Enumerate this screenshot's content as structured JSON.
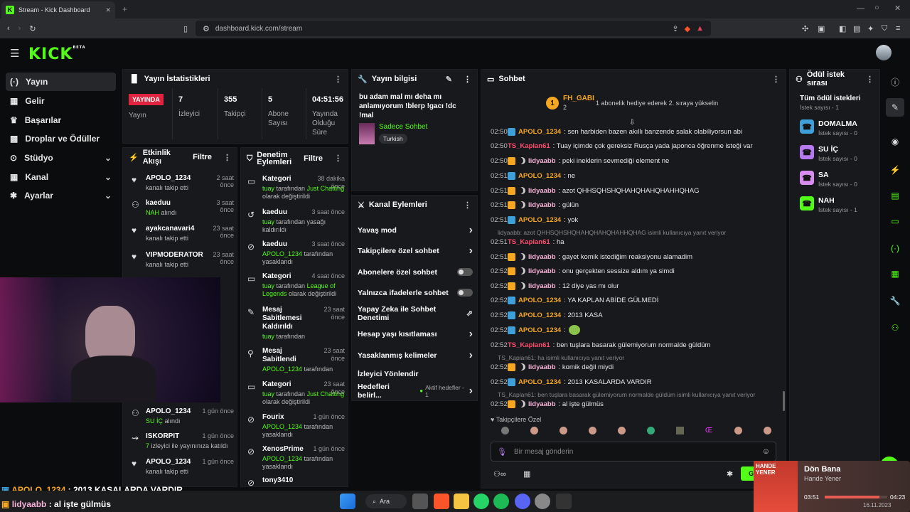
{
  "browser": {
    "tab_title": "Stream - Kick Dashboard",
    "url": "dashboard.kick.com/stream"
  },
  "brand": {
    "logo": "KICK",
    "beta": "BETA",
    "accent": "#53fc18"
  },
  "sidebar": {
    "items": [
      {
        "label": "Yayın",
        "icon": "broadcast-icon"
      },
      {
        "label": "Gelir",
        "icon": "revenue-icon"
      },
      {
        "label": "Başarılar",
        "icon": "trophy-icon"
      },
      {
        "label": "Droplar ve Ödüller",
        "icon": "gift-icon"
      },
      {
        "label": "Stüdyo",
        "icon": "studio-icon"
      },
      {
        "label": "Kanal",
        "icon": "channel-icon"
      },
      {
        "label": "Ayarlar",
        "icon": "gear-icon"
      }
    ]
  },
  "stats": {
    "title": "Yayın İstatistikleri",
    "live_badge": "YAYINDA",
    "live_label": "Yayın",
    "items": [
      {
        "value": "7",
        "label": "İzleyici"
      },
      {
        "value": "355",
        "label": "Takipçi"
      },
      {
        "value": "5",
        "label": "Abone Sayısı"
      },
      {
        "value": "04:51:56",
        "label": "Yayında Olduğu Süre"
      }
    ]
  },
  "stream_info": {
    "title": "Yayın bilgisi",
    "text": "bu adam mal mı deha mı anlamıyorum !blerp !gacı !dc !mal",
    "chat_mode": "Sadece Sohbet",
    "tag": "Turkish"
  },
  "activity": {
    "title": "Etkinlik Akışı",
    "filter": "Filtre",
    "items": [
      {
        "name": "APOLO_1234",
        "time": "2 saat önce",
        "desc": "kanalı takip etti"
      },
      {
        "name": "kaeduu",
        "time": "3 saat önce",
        "hl": "NAH",
        "desc": " alındı"
      },
      {
        "name": "ayakcanavari4",
        "time": "23 saat önce",
        "desc": "kanalı takip etti"
      },
      {
        "name": "VIPMODERATOR",
        "time": "23 saat önce",
        "desc": "kanalı takip etti"
      },
      {
        "name": "APOLO_1234",
        "time": "1 gün önce",
        "hl": "SU İÇ",
        "desc": " alındı"
      },
      {
        "name": "ISKORPIT",
        "time": "1 gün önce",
        "hl": "7",
        "desc": " izleyici ile yayınınıza katıldı"
      },
      {
        "name": "APOLO_1234",
        "time": "1 gün önce",
        "desc": "kanalı takip etti"
      }
    ]
  },
  "modlog": {
    "title": "Denetim Eylemleri",
    "filter": "Filtre",
    "items": [
      {
        "name": "Kategori",
        "time": "38 dakika önce",
        "actor": "tuay",
        "desc": " tarafından ",
        "hl2": "Just Chatting",
        "desc2": " olarak değiştirildi"
      },
      {
        "name": "kaeduu",
        "time": "3 saat önce",
        "actor": "tuay",
        "desc": " tarafından yasağı kaldırıldı"
      },
      {
        "name": "kaeduu",
        "time": "3 saat önce",
        "actor": "APOLO_1234",
        "desc": " tarafından yasaklandı"
      },
      {
        "name": "Kategori",
        "time": "4 saat önce",
        "actor": "tuay",
        "desc": " tarafından ",
        "hl2": "League of Legends",
        "desc2": " olarak değiştirildi"
      },
      {
        "name": "Mesaj Sabitlemesi Kaldırıldı",
        "time": "23 saat önce",
        "actor": "tuay",
        "desc": " tarafından"
      },
      {
        "name": "Mesaj Sabitlendi",
        "time": "23 saat önce",
        "actor": "APOLO_1234",
        "desc": " tarafından"
      },
      {
        "name": "Kategori",
        "time": "23 saat önce",
        "actor": "tuay",
        "desc": " tarafından ",
        "hl2": "Just Chatting",
        "desc2": " olarak değiştirildi"
      },
      {
        "name": "Fourix",
        "time": "1 gün önce",
        "actor": "APOLO_1234",
        "desc": " tarafından yasaklandı"
      },
      {
        "name": "XenosPrime",
        "time": "1 gün önce",
        "actor": "APOLO_1234",
        "desc": " tarafından yasaklandı"
      },
      {
        "name": "tony3410",
        "time": "",
        "actor": "",
        "desc": ""
      }
    ]
  },
  "channel_actions": {
    "title": "Kanal Eylemleri",
    "rows": [
      {
        "label": "Yavaş mod",
        "kind": "chevron"
      },
      {
        "label": "Takipçilere özel sohbet",
        "kind": "chevron"
      },
      {
        "label": "Abonelere özel sohbet",
        "kind": "toggle"
      },
      {
        "label": "Yalnızca ifadelerle sohbet",
        "kind": "toggle"
      },
      {
        "label": "Yapay Zeka ile Sohbet Denetimi",
        "kind": "external"
      },
      {
        "label": "Hesap yaşı kısıtlaması",
        "kind": "chevron"
      },
      {
        "label": "Yasaklanmış kelimeler",
        "kind": "chevron"
      },
      {
        "label": "İzleyici Yönlendir",
        "kind": "none"
      },
      {
        "label": "Hedefleri belirl...",
        "kind": "chevron",
        "extra": "Aktif hedefler - 1"
      }
    ]
  },
  "chat": {
    "title": "Sohbet",
    "pinned_user": "FH_GABI",
    "pinned_count": "2",
    "pinned_rank": "1",
    "pinned_msg": "1 abonelik hediye ederek 2. sıraya yükselin",
    "messages": [
      {
        "t": "02:50",
        "u": "APOLO_1234",
        "c": "#f5a623",
        "b": "m",
        "m": ": sen harbiden bazen akıllı banzende salak olabiliyorsun abi"
      },
      {
        "t": "02:50",
        "u": "TS_Kaplan61",
        "c": "#ff4d6d",
        "b": "",
        "m": ": Tuay içimde çok gereksiz Rusça yada japonca öğrenme isteği var"
      },
      {
        "t": "02:50",
        "u": "lidyaabb",
        "c": "#f7b2d9",
        "b": "cm",
        "m": ": peki ineklerin sevmediği element ne"
      },
      {
        "t": "02:51",
        "u": "APOLO_1234",
        "c": "#f5a623",
        "b": "m",
        "m": ": ne"
      },
      {
        "t": "02:51",
        "u": "lidyaabb",
        "c": "#f7b2d9",
        "b": "cm",
        "m": ": azot QHHSQHSHQHAHQHAHQHAHHQHAG"
      },
      {
        "t": "02:51",
        "u": "lidyaabb",
        "c": "#f7b2d9",
        "b": "cm",
        "m": ": gülün"
      },
      {
        "t": "02:51",
        "u": "APOLO_1234",
        "c": "#f5a623",
        "b": "m",
        "m": ": yok"
      },
      {
        "reply": "lidyaabb: azot QHHSQHSHQHAHQHAHQHAHHQHAG isimli kullanıcıya yanıt veriyor"
      },
      {
        "t": "02:51",
        "u": "TS_Kaplan61",
        "c": "#ff4d6d",
        "b": "",
        "m": ": ha"
      },
      {
        "t": "02:51",
        "u": "lidyaabb",
        "c": "#f7b2d9",
        "b": "cm",
        "m": ": gayet komik istediğim reaksiyonu alamadim"
      },
      {
        "t": "02:52",
        "u": "lidyaabb",
        "c": "#f7b2d9",
        "b": "cm",
        "m": ": onu gerçekten sessize aldım ya simdi"
      },
      {
        "t": "02:52",
        "u": "lidyaabb",
        "c": "#f7b2d9",
        "b": "cm",
        "m": ": 12 diye yas mı olur"
      },
      {
        "t": "02:52",
        "u": "APOLO_1234",
        "c": "#f5a623",
        "b": "m",
        "m": ": YA KAPLAN ABİDE GÜLMEDİ"
      },
      {
        "t": "02:52",
        "u": "APOLO_1234",
        "c": "#f5a623",
        "b": "m",
        "m": ": 2013 KASA"
      },
      {
        "t": "02:52",
        "u": "APOLO_1234",
        "c": "#f5a623",
        "b": "m",
        "m": ":",
        "emote": true
      },
      {
        "t": "02:52",
        "u": "TS_Kaplan61",
        "c": "#ff4d6d",
        "b": "",
        "m": ": ben tuşlara basarak gülemiyorum normalde güldüm"
      },
      {
        "reply": "TS_Kaplan61: ha isimli kullanıcıya yanıt veriyor"
      },
      {
        "t": "02:52",
        "u": "lidyaabb",
        "c": "#f7b2d9",
        "b": "cm",
        "m": ": komik değil miydi"
      },
      {
        "t": "02:52",
        "u": "APOLO_1234",
        "c": "#f5a623",
        "b": "m",
        "m": ": 2013 KASALARDA VARDIR"
      },
      {
        "reply": "TS_Kaplan61: ben tuşlara basarak gülemiyorum normalde güldüm isimli kullanıcıya yanıt veriyor"
      },
      {
        "t": "02:52",
        "u": "lidyaabb",
        "c": "#f7b2d9",
        "b": "cm",
        "m": ": al işte gülmüs"
      }
    ],
    "followers_only": "Takipçilere Özel",
    "placeholder": "Bir mesaj gönderin",
    "send_label": "Gön"
  },
  "rewards": {
    "title": "Ödül istek sırası",
    "all_title": "Tüm ödül istekleri",
    "count_label": "İstek sayısı - 1",
    "items": [
      {
        "name": "DOMALMA",
        "count": "İstek sayısı - 0",
        "color": "#3fa0d9"
      },
      {
        "name": "SU İÇ",
        "count": "İstek sayısı - 0",
        "color": "#b779f0"
      },
      {
        "name": "SA",
        "count": "İstek sayısı - 0",
        "color": "#d98cf0"
      },
      {
        "name": "NAH",
        "count": "İstek sayısı - 1",
        "color": "#53fc18"
      }
    ]
  },
  "overlay": {
    "line1_user": "APOLO_1234",
    "line1_msg": " : 2013 KASALARDA VARDIR",
    "line2_user": "lidyaabb",
    "line2_msg": " : al işte gülmüs"
  },
  "music": {
    "title": "Dön Bana",
    "artist": "Hande Yener",
    "elapsed": "03:51",
    "total": "04:23",
    "cover_text": "HANDE YENER",
    "progress": 0.88,
    "date": "16.11.2023"
  },
  "taskbar": {
    "search": "Ara"
  }
}
